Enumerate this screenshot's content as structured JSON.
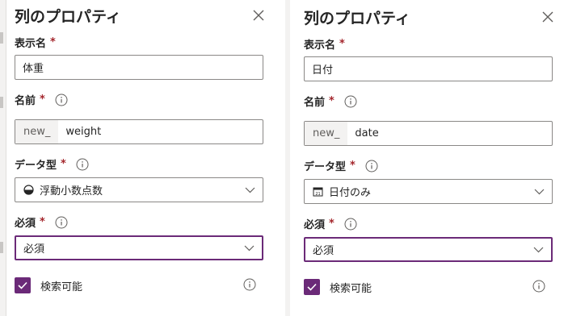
{
  "colors": {
    "accent": "#6b2a78",
    "required": "#a4262c",
    "border": "#8a8886"
  },
  "panels": [
    {
      "title": "列のプロパティ",
      "display_name": {
        "label": "表示名",
        "required": "*",
        "value": "体重"
      },
      "name": {
        "label": "名前",
        "required": "*",
        "prefix": "new_",
        "value": "weight"
      },
      "data_type": {
        "label": "データ型",
        "required": "*",
        "icon": "float-number-icon",
        "value": "浮動小数点数"
      },
      "requirement": {
        "label": "必須",
        "required": "*",
        "value": "必須"
      },
      "searchable": {
        "label": "検索可能",
        "checked": true
      }
    },
    {
      "title": "列のプロパティ",
      "display_name": {
        "label": "表示名",
        "required": "*",
        "value": "日付"
      },
      "name": {
        "label": "名前",
        "required": "*",
        "prefix": "new_",
        "value": "date"
      },
      "data_type": {
        "label": "データ型",
        "required": "*",
        "icon": "calendar-icon",
        "value": "日付のみ"
      },
      "requirement": {
        "label": "必須",
        "required": "*",
        "value": "必須"
      },
      "searchable": {
        "label": "検索可能",
        "checked": true
      }
    }
  ]
}
